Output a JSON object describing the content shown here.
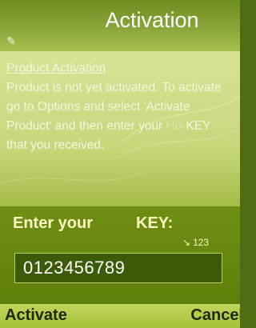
{
  "window": {
    "title": "Activation",
    "title_icon": "pen-icon",
    "title_glyph": "✎"
  },
  "content": {
    "heading": "Product Activation",
    "line1": "Product is not yet activated. To activate",
    "line2": "go to Options and select 'Activate",
    "line3_before": "Product' and then enter your ",
    "line3_faint": "Ho-",
    "line3_key": "KEY",
    "line4": "that you received."
  },
  "dialog": {
    "prompt": "Enter your",
    "prompt_key": "KEY:",
    "input_mode_icon": "input-mode-icon",
    "input_mode_glyph": "↘",
    "input_mode": "123",
    "input_value": "0123456789"
  },
  "softkeys": {
    "left": "Activate",
    "right": "Cancel"
  },
  "colors": {
    "dialog_bg": "#5f7f0c",
    "text_light": "#f4f6e2",
    "prompt_text": "#fbf6c2",
    "softkey_text": "#1e2a06"
  }
}
